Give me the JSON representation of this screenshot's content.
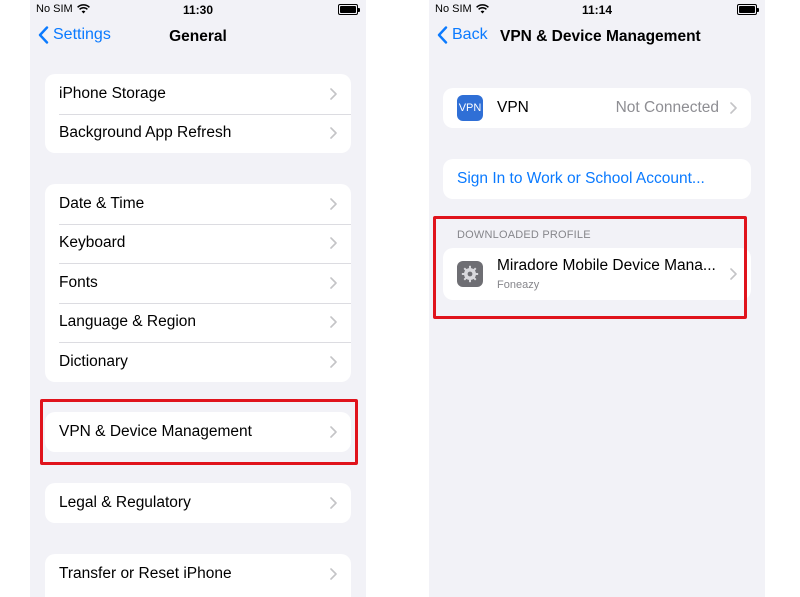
{
  "left": {
    "status": {
      "carrier": "No SIM",
      "time": "11:30"
    },
    "nav": {
      "back": "Settings",
      "title": "General"
    },
    "groups": [
      [
        "iPhone Storage",
        "Background App Refresh"
      ],
      [
        "Date & Time",
        "Keyboard",
        "Fonts",
        "Language & Region",
        "Dictionary"
      ],
      [
        "VPN & Device Management"
      ],
      [
        "Legal & Regulatory"
      ],
      [
        "Transfer or Reset iPhone"
      ]
    ]
  },
  "right": {
    "status": {
      "carrier": "No SIM",
      "time": "11:14"
    },
    "nav": {
      "back": "Back",
      "title": "VPN & Device Management"
    },
    "vpn": {
      "icon_text": "VPN",
      "label": "VPN",
      "value": "Not Connected"
    },
    "sign_in": "Sign In to Work or School Account...",
    "section_header": "DOWNLOADED PROFILE",
    "profile": {
      "title": "Miradore Mobile Device Mana...",
      "subtitle": "Foneazy"
    }
  },
  "colors": {
    "accent": "#0a7aff",
    "highlight": "#e0131c",
    "background": "#f2f2f7"
  }
}
